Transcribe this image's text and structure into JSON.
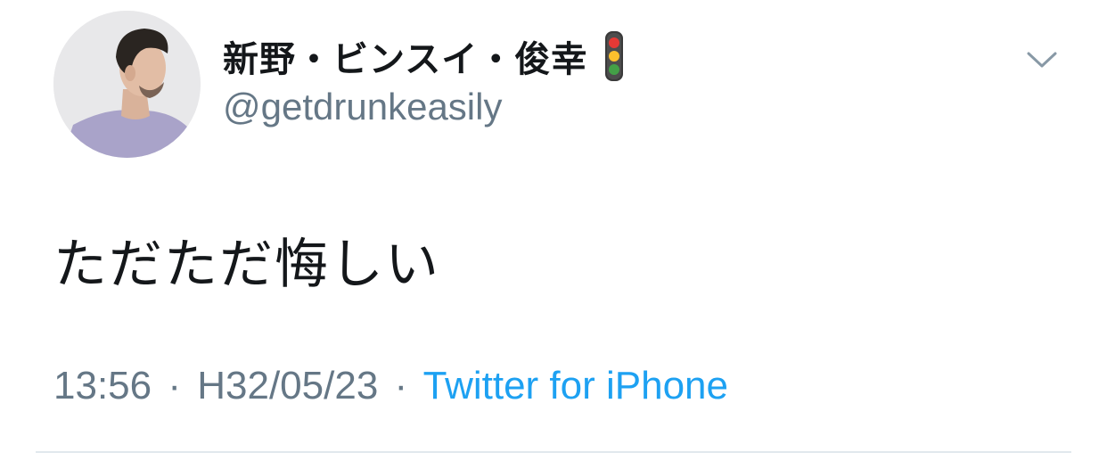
{
  "user": {
    "display_name": "新野・ビンスイ・俊幸",
    "name_emoji": "vertical-traffic-light-icon",
    "handle": "@getdrunkeasily"
  },
  "tweet": {
    "text": "ただただ悔しい",
    "time": "13:56",
    "date": "H32/05/23",
    "separator": "·",
    "source": "Twitter for iPhone"
  },
  "colors": {
    "primary_text": "#14171a",
    "secondary_text": "#657786",
    "link": "#1da1f2",
    "divider": "#e1e8ed"
  }
}
